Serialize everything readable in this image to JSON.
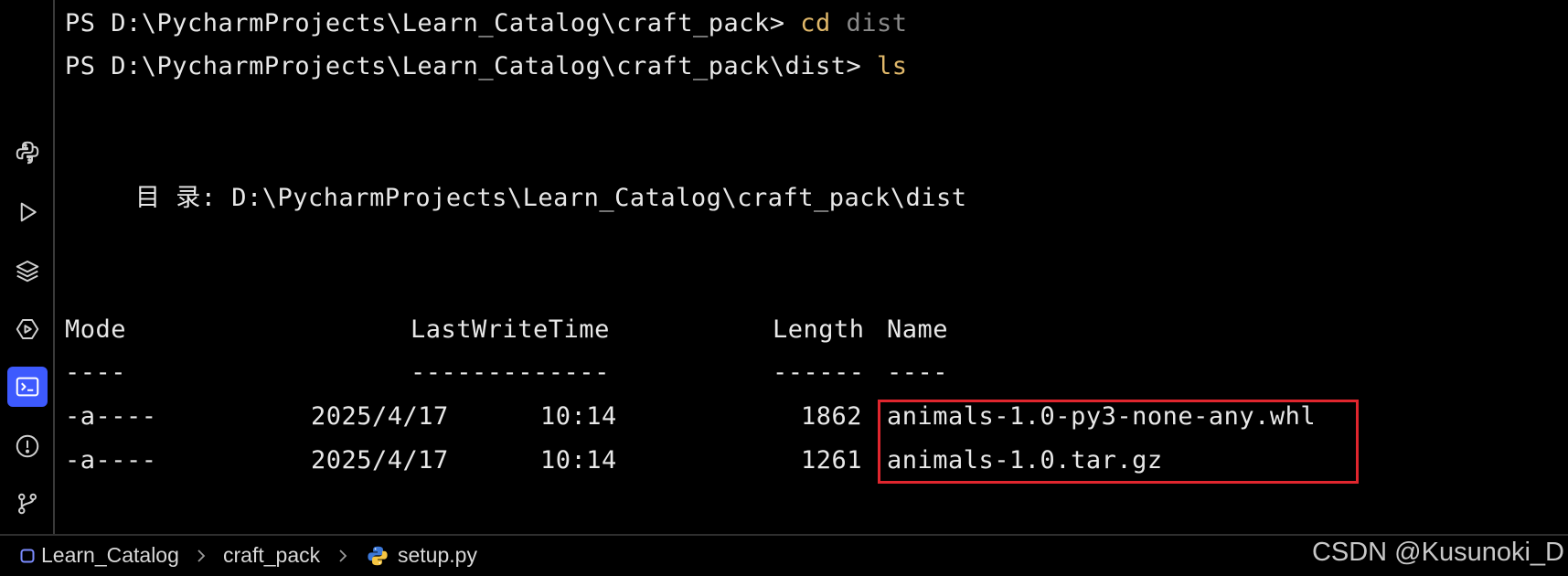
{
  "activity_bar": {
    "icons": [
      "python-console-icon",
      "run-icon",
      "layers-icon",
      "services-icon",
      "terminal-icon",
      "problems-icon",
      "git-icon"
    ],
    "active": "terminal-icon",
    "accent_color": "#3d5afe"
  },
  "terminal": {
    "line1": {
      "prompt": "PS D:\\PycharmProjects\\Learn_Catalog\\craft_pack> ",
      "command": "cd",
      "argument": " dist"
    },
    "line2": {
      "prompt": "PS D:\\PycharmProjects\\Learn_Catalog\\craft_pack\\dist> ",
      "command": "ls"
    },
    "directory_line": "目 录: D:\\PycharmProjects\\Learn_Catalog\\craft_pack\\dist",
    "table": {
      "headers": {
        "mode": "Mode",
        "last_write_time": "LastWriteTime",
        "length": "Length",
        "name": "Name"
      },
      "underlines": {
        "mode": "----",
        "last_write_time": "-------------",
        "length": "------",
        "name": "----"
      },
      "rows": [
        {
          "mode": "-a----",
          "date": "2025/4/17",
          "time": "10:14",
          "length": "1862",
          "name": "animals-1.0-py3-none-any.whl"
        },
        {
          "mode": "-a----",
          "date": "2025/4/17",
          "time": "10:14",
          "length": "1261",
          "name": "animals-1.0.tar.gz"
        }
      ]
    },
    "highlight_color": "#e0262e"
  },
  "breadcrumb": {
    "items": [
      "Learn_Catalog",
      "craft_pack",
      "setup.py"
    ]
  },
  "watermark": "CSDN @Kusunoki_D"
}
